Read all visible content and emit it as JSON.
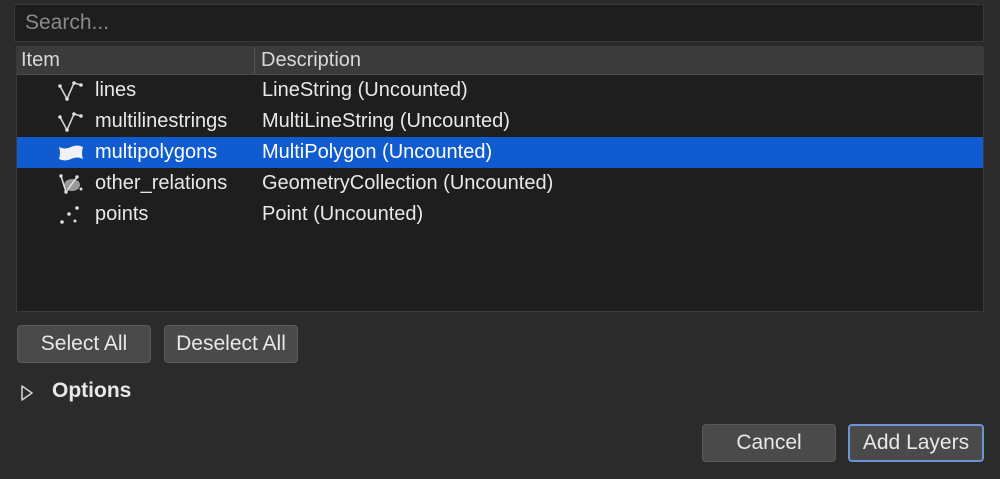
{
  "search": {
    "placeholder": "Search..."
  },
  "table": {
    "columns": [
      "Item",
      "Description"
    ],
    "rows": [
      {
        "name": "lines",
        "description": "LineString (Uncounted)",
        "icon": "line-layer-icon"
      },
      {
        "name": "multilinestrings",
        "description": "MultiLineString (Uncounted)",
        "icon": "line-layer-icon"
      },
      {
        "name": "multipolygons",
        "description": "MultiPolygon (Uncounted)",
        "icon": "polygon-layer-icon",
        "selected": true
      },
      {
        "name": "other_relations",
        "description": "GeometryCollection (Uncounted)",
        "icon": "geometry-collection-icon"
      },
      {
        "name": "points",
        "description": "Point (Uncounted)",
        "icon": "point-layer-icon"
      }
    ]
  },
  "buttons": {
    "select_all": "Select All",
    "deselect_all": "Deselect All",
    "cancel": "Cancel",
    "add_layers": "Add Layers"
  },
  "options": {
    "label": "Options",
    "expanded": false
  },
  "colors": {
    "selection": "#0f5bcf",
    "background": "#2b2b2b",
    "list_background": "#1e1e1e"
  }
}
